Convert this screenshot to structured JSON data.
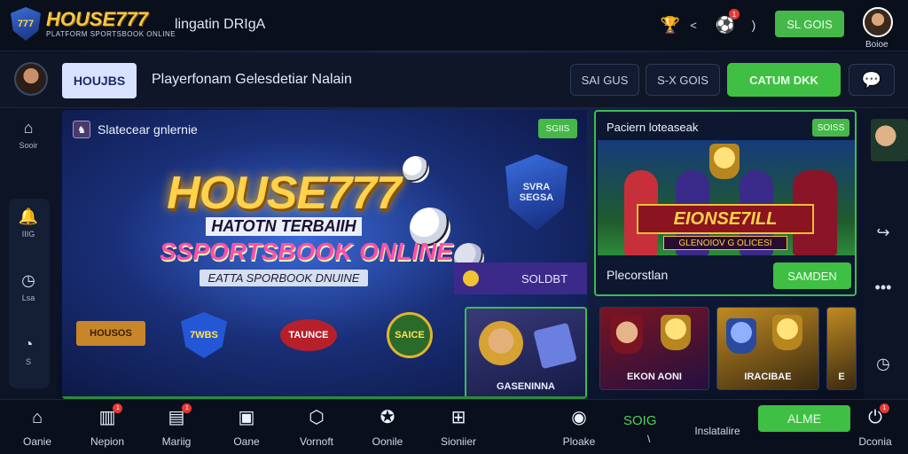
{
  "topbar": {
    "logo_text": "HOUSE777",
    "logo_sub": "PLATFORM SPORTSBOOK ONLINE",
    "title": "lingatin DRIgA",
    "paren": ")",
    "button": "SL GOIS",
    "avatar_label": "Boioe",
    "notif_count": "1"
  },
  "subbar": {
    "tag": "HOUJBS",
    "title": "Playerfonam Gelesdetiar Nalain",
    "btn1": "SAI GUS",
    "btn2": "S-X GOIS",
    "green_btn": "CATUM DKK"
  },
  "rail": [
    {
      "label": "Sooir",
      "icon": "home-outline-icon"
    },
    {
      "label": "IIIG",
      "icon": "bell-icon"
    },
    {
      "label": "Lsa",
      "icon": "clock-icon"
    },
    {
      "label": "S",
      "icon": "stopwatch-icon"
    }
  ],
  "hero": {
    "heading": "Slatecear gnlernie",
    "mini": "SGIIS",
    "brand": "HOUSE777",
    "line1": "HATOTN TERBAIIH",
    "line2": "SSPORTSBOOK ONLINE",
    "line3": "EATTA SPORBOOK DNUINE",
    "solobt": "SOLDBT",
    "shield_text": "SVRA SEGSA",
    "leagues": [
      "HOUSOS",
      "7WBS",
      "TAUNCE",
      "SAICE"
    ],
    "card_label": "GASENINNA"
  },
  "feature": {
    "title": "Paciern loteaseak",
    "mini": "SOISS",
    "brand": "EIONSE7ILL",
    "brand2": "GLENOIOV G OLICESI",
    "footer_label": "Plecorstlan",
    "footer_btn": "SAMDEN"
  },
  "thumbs": [
    {
      "label": "EKON AONI"
    },
    {
      "label": "IRACIBAE"
    },
    {
      "label": "E"
    }
  ],
  "bottomnav": {
    "items": [
      {
        "label": "Oanie",
        "icon": "home-icon"
      },
      {
        "label": "Nepion",
        "icon": "chart-bars-icon",
        "badge": "1"
      },
      {
        "label": "Mariig",
        "icon": "chart-columns-icon",
        "badge": "1"
      },
      {
        "label": "Oane",
        "icon": "tablet-icon"
      },
      {
        "label": "Vornoft",
        "icon": "cube-icon"
      },
      {
        "label": "Oonile",
        "icon": "soccer-ball-icon"
      },
      {
        "label": "Sioniier",
        "icon": "scoreboard-icon"
      },
      {
        "label": "Ploake",
        "icon": "eye-icon"
      },
      {
        "label": "Inslatalire",
        "icon": "link-icon"
      },
      {
        "label": "Dconia",
        "icon": "power-icon",
        "badge": "1"
      }
    ],
    "green_text": "SOIG",
    "slash": "\\",
    "button": "ALME"
  },
  "colors": {
    "accent_green": "#3fbf43",
    "brand_gold": "#ffd24a",
    "background": "#0b1220"
  }
}
